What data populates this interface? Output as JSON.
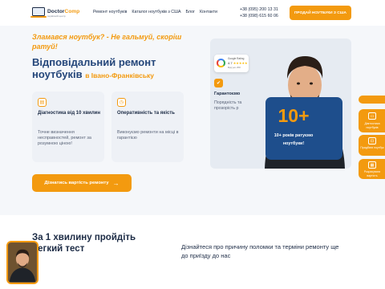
{
  "header": {
    "logo_part1": "Doctor",
    "logo_part2": "Comp",
    "logo_sub": "сервісний центр",
    "nav": [
      "Ремонт ноутбуків",
      "Каталог ноутбуків з США",
      "Блог",
      "Контакти"
    ],
    "phone1": "+38 (095) 200 13 31",
    "phone2": "+38 (098) 615 60 06",
    "sell_button": "ПРОДАЙ НОУТБУКИ З США"
  },
  "hero": {
    "tagline": "Зламався ноутбук? - Не гальмуй, скоріш ратуй!",
    "title": "Відповідальний ремонт ноутбуків",
    "title_city": "в Івано-Франківську",
    "cards": [
      {
        "title": "Діагностика від 10 хвилин",
        "text": "Точне визначення несправностей, ремонт за розумною ціною!",
        "icon": "clipboard-icon"
      },
      {
        "title": "Оперативність та якість",
        "text": "Виконуємо ремонти на місці в гарантією",
        "icon": "clock-icon"
      }
    ],
    "cta": "Дізнатись вартість ремонту",
    "google": {
      "label": "Google Rating",
      "rating": "4.7",
      "stars": "★★★★★",
      "reviews": "Відгуки 258"
    },
    "guarantee": {
      "title": "Гарантоємо",
      "text": "Порядність та прозорість р"
    },
    "years": {
      "number": "10+",
      "text": "10+ років ратуємо ноутбуки!"
    }
  },
  "side_buttons": [
    {
      "label": ""
    },
    {
      "label": "Діагностика ноутбуків"
    },
    {
      "label": "Придбати ноутбук"
    },
    {
      "label": "Розрахувати вартість"
    }
  ],
  "bottom": {
    "heading": "За 1 хвилину пройдіть легкий тест",
    "paragraph": "Дізнайтеся про причину поломки та терміни ремонту ще до приїзду до нас"
  },
  "colors": {
    "accent": "#f39a0f",
    "primary": "#24467a",
    "dark_card": "#1e4e8c"
  }
}
